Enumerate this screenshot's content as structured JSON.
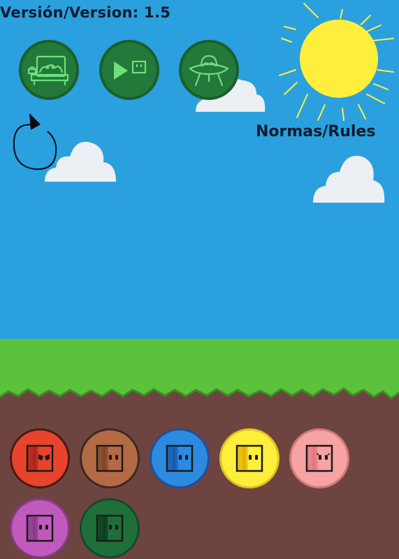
{
  "header": {
    "version_text": "Versión/Version: 1.5",
    "rules_label": "Normas/Rules"
  },
  "mode_buttons": [
    {
      "id": "bed",
      "icon": "bed-scene-icon"
    },
    {
      "id": "play",
      "icon": "play-icon"
    },
    {
      "id": "ufo",
      "icon": "ufo-icon"
    }
  ],
  "skins": [
    {
      "color": "#e8432d",
      "border": "#4a1a14",
      "face_dark": "#a8241a",
      "eyes": "angry"
    },
    {
      "color": "#b46a44",
      "border": "#3b2a24",
      "face_dark": "#7e4629",
      "eyes": "normal"
    },
    {
      "color": "#2c8ae0",
      "border": "#1f4f9a",
      "face_dark": "#1a58b0",
      "eyes": "normal"
    },
    {
      "color": "#ffef3c",
      "border": "#e0c420",
      "face_dark": "#e6b000",
      "eyes": "normal"
    },
    {
      "color": "#f7a3a3",
      "border": "#d07a7a",
      "face_dark": "#e07a80",
      "eyes": "lashes"
    },
    {
      "color": "#c05bbd",
      "border": "#8a3a88",
      "face_dark": "#8a3a88",
      "eyes": "normal"
    },
    {
      "color": "#1f6f3a",
      "border": "#154a27",
      "face_dark": "#0f3a20",
      "eyes": "normal"
    }
  ],
  "colors": {
    "sky": "#2ba0de",
    "grass": "#5cc23c",
    "grass_dark": "#3a8e28",
    "dirt": "#6e4440",
    "sun": "#ffef3c",
    "button_green": "#22793a",
    "button_icon": "#6ee07a"
  }
}
